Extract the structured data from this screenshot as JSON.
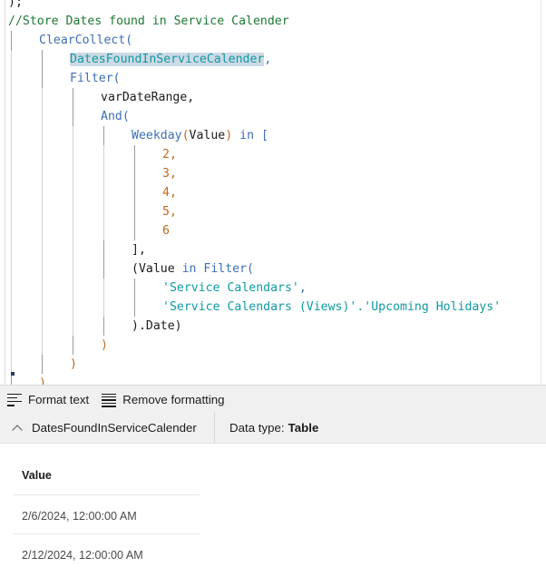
{
  "editor": {
    "language": "PowerFx",
    "lines": [
      {
        "indent": 0,
        "tokens": [
          {
            "t": ");",
            "c": "t-plain"
          }
        ]
      },
      {
        "indent": 0,
        "tokens": [
          {
            "t": "//Store Dates found in Service Calender",
            "c": "t-comment"
          }
        ]
      },
      {
        "indent": 1,
        "tokens": [
          {
            "t": "ClearCollect(",
            "c": "t-func"
          }
        ]
      },
      {
        "indent": 2,
        "tokens": [
          {
            "t": "DatesFoundInServiceCalender",
            "c": "t-ident sel"
          },
          {
            "t": ",",
            "c": "t-punct"
          }
        ]
      },
      {
        "indent": 2,
        "tokens": [
          {
            "t": "Filter(",
            "c": "t-func"
          }
        ]
      },
      {
        "indent": 3,
        "tokens": [
          {
            "t": "varDateRange,",
            "c": "t-plain"
          }
        ]
      },
      {
        "indent": 3,
        "tokens": [
          {
            "t": "And(",
            "c": "t-func"
          }
        ]
      },
      {
        "indent": 4,
        "tokens": [
          {
            "t": "Weekday",
            "c": "t-func"
          },
          {
            "t": "(",
            "c": "t-paren2"
          },
          {
            "t": "Value",
            "c": "t-plain"
          },
          {
            "t": ")",
            "c": "t-paren2"
          },
          {
            "t": " in [",
            "c": "t-func"
          }
        ]
      },
      {
        "indent": 5,
        "tokens": [
          {
            "t": "2,",
            "c": "t-num"
          }
        ]
      },
      {
        "indent": 5,
        "tokens": [
          {
            "t": "3,",
            "c": "t-num"
          }
        ]
      },
      {
        "indent": 5,
        "tokens": [
          {
            "t": "4,",
            "c": "t-num"
          }
        ]
      },
      {
        "indent": 5,
        "tokens": [
          {
            "t": "5,",
            "c": "t-num"
          }
        ]
      },
      {
        "indent": 5,
        "tokens": [
          {
            "t": "6",
            "c": "t-num"
          }
        ]
      },
      {
        "indent": 4,
        "tokens": [
          {
            "t": "],",
            "c": "t-plain"
          }
        ]
      },
      {
        "indent": 4,
        "tokens": [
          {
            "t": "(",
            "c": "t-plain"
          },
          {
            "t": "Value",
            "c": "t-plain"
          },
          {
            "t": " in ",
            "c": "t-func"
          },
          {
            "t": "Filter(",
            "c": "t-func"
          }
        ]
      },
      {
        "indent": 5,
        "tokens": [
          {
            "t": "'Service Calendars'",
            "c": "t-str"
          },
          {
            "t": ",",
            "c": "t-punct"
          }
        ]
      },
      {
        "indent": 5,
        "tokens": [
          {
            "t": "'Service Calendars (Views)'.'Upcoming Holidays'",
            "c": "t-str"
          }
        ]
      },
      {
        "indent": 4,
        "tokens": [
          {
            "t": ").Date)",
            "c": "t-plain"
          }
        ]
      },
      {
        "indent": 3,
        "tokens": [
          {
            "t": ")",
            "c": "t-paren2"
          }
        ]
      },
      {
        "indent": 2,
        "tokens": [
          {
            "t": ")",
            "c": "t-paren2"
          }
        ]
      },
      {
        "indent": 1,
        "tokens": [
          {
            "t": ")",
            "c": "t-paren2"
          }
        ]
      },
      {
        "indent": 0,
        "tokens": [
          {
            "t": ")",
            "c": "t-paren2"
          }
        ]
      },
      {
        "indent": 0,
        "tokens": [
          {
            "t": "\\,",
            "c": "t-plain"
          }
        ]
      }
    ]
  },
  "toolbar": {
    "format_text_label": "Format text",
    "remove_formatting_label": "Remove formatting",
    "format_icon": "format-text-icon",
    "remove_icon": "remove-formatting-icon"
  },
  "result_header": {
    "collapse_icon": "chevron-up-icon",
    "name": "DatesFoundInServiceCalender",
    "data_type_prefix": "Data type:",
    "data_type_value": "Table"
  },
  "result_table": {
    "columns": [
      "Value"
    ],
    "rows": [
      [
        "2/6/2024, 12:00:00 AM"
      ],
      [
        "2/12/2024, 12:00:00 AM"
      ]
    ]
  },
  "colors": {
    "comment": "#1d7a33",
    "function": "#3c6fb5",
    "identifier": "#0f9aa3",
    "string": "#0f9aa3",
    "number": "#c06a1e",
    "selection": "#cdd9e4",
    "toolbar_bg": "#f0f0f0"
  }
}
